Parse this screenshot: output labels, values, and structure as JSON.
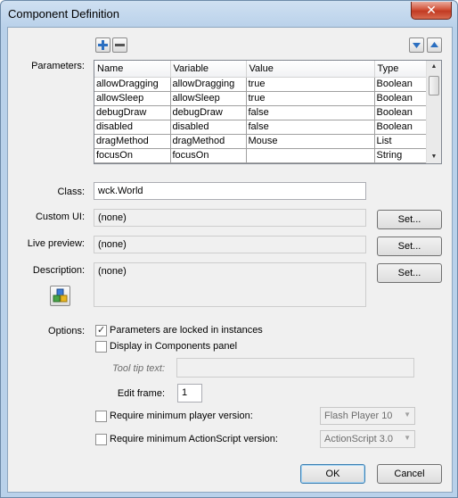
{
  "window": {
    "title": "Component Definition",
    "close_glyph": "✕"
  },
  "labels": {
    "parameters": "Parameters:",
    "class": "Class:",
    "custom_ui": "Custom UI:",
    "live_preview": "Live preview:",
    "description": "Description:",
    "options": "Options:"
  },
  "toolbar": {
    "add": "+",
    "remove": "−",
    "move_down": "▼",
    "move_up": "▲"
  },
  "parameters_table": {
    "columns": [
      "Name",
      "Variable",
      "Value",
      "Type"
    ],
    "rows": [
      [
        "allowDragging",
        "allowDragging",
        "true",
        "Boolean"
      ],
      [
        "allowSleep",
        "allowSleep",
        "true",
        "Boolean"
      ],
      [
        "debugDraw",
        "debugDraw",
        "false",
        "Boolean"
      ],
      [
        "disabled",
        "disabled",
        "false",
        "Boolean"
      ],
      [
        "dragMethod",
        "dragMethod",
        "Mouse",
        "List"
      ],
      [
        "focusOn",
        "focusOn",
        "",
        "String"
      ]
    ]
  },
  "fields": {
    "class_value": "wck.World",
    "custom_ui_value": "(none)",
    "live_preview_value": "(none)",
    "description_value": "(none)",
    "tooltip_label": "Tool tip text:",
    "tooltip_value": "",
    "edit_frame_label": "Edit frame:",
    "edit_frame_value": "1"
  },
  "buttons": {
    "set": "Set...",
    "ok": "OK",
    "cancel": "Cancel"
  },
  "options": {
    "locked_label": "Parameters are locked in instances",
    "locked_checked": true,
    "display_label": "Display in Components panel",
    "display_checked": false,
    "min_player_label": "Require minimum player version:",
    "min_player_checked": false,
    "min_player_value": "Flash Player 10",
    "min_as_label": "Require minimum ActionScript version:",
    "min_as_checked": false,
    "min_as_value": "ActionScript 3.0"
  },
  "icons": {
    "component_icon": "component-cubes-icon"
  },
  "colors": {
    "accent": "#3c7fb1",
    "close": "#c23a22"
  }
}
